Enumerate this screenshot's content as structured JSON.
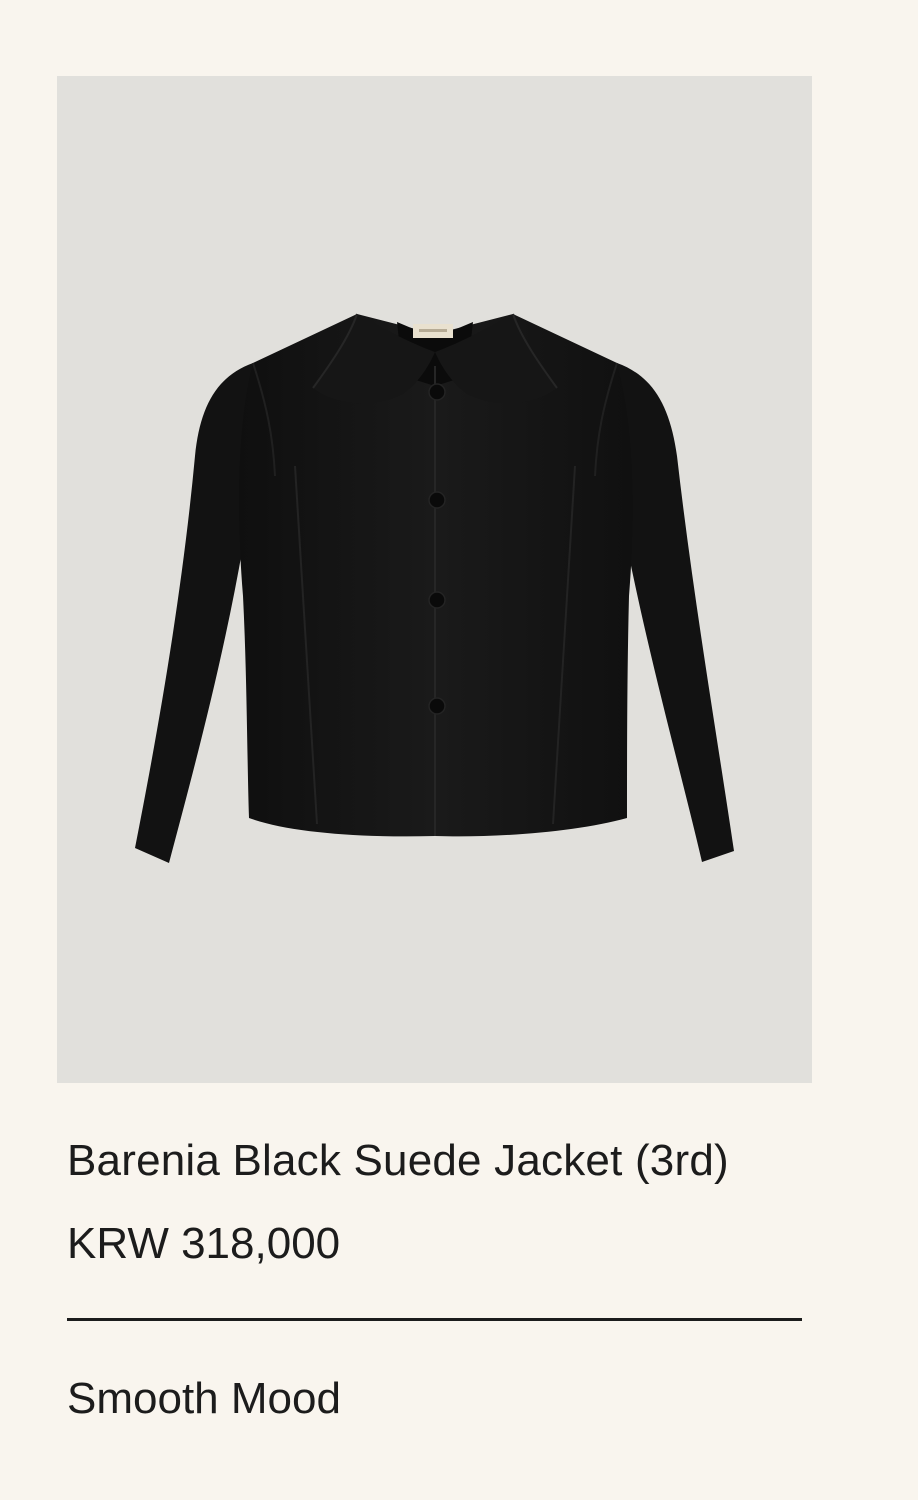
{
  "product": {
    "name": "Barenia Black Suede Jacket (3rd)",
    "price": "KRW 318,000",
    "tag": "Smooth Mood",
    "image": {
      "subject": "jacket",
      "colors": {
        "background": "#e1e0dc",
        "garment": "#141414",
        "label": "#e9e1cf"
      }
    }
  },
  "colors": {
    "page_background": "#f9f5ee",
    "text": "#1c1c1c"
  }
}
